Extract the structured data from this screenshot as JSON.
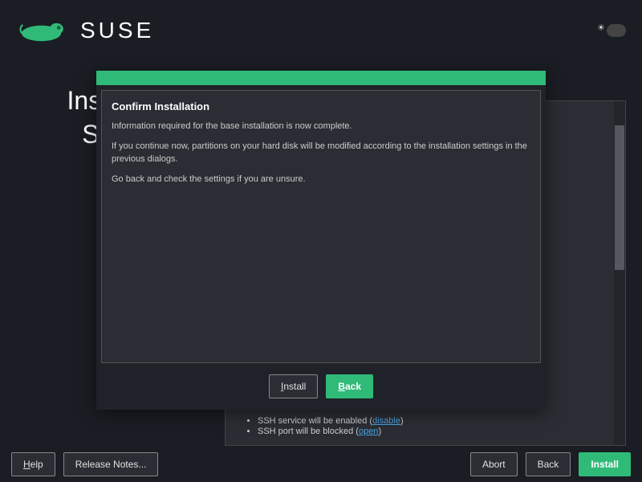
{
  "brand": "SUSE",
  "page_title_line1": "Installation",
  "page_title_line2": "Settings",
  "background_settings": {
    "ssh_service": {
      "text": "SSH service will be enabled (",
      "link": "disable",
      "close": ")"
    },
    "ssh_port": {
      "text": "SSH port will be blocked (",
      "link": "open",
      "close": ")"
    }
  },
  "footer": {
    "help": "Help",
    "release_notes": "Release Notes...",
    "abort": "Abort",
    "back": "Back",
    "install": "Install"
  },
  "modal": {
    "title": "Confirm Installation",
    "p1": "Information required for the base installation is now complete.",
    "p2": "If you continue now, partitions on your hard disk will be modified according to the installation settings in the previous dialogs.",
    "p3": "Go back and check the settings if you are unsure.",
    "install": "Install",
    "back": "Back"
  }
}
